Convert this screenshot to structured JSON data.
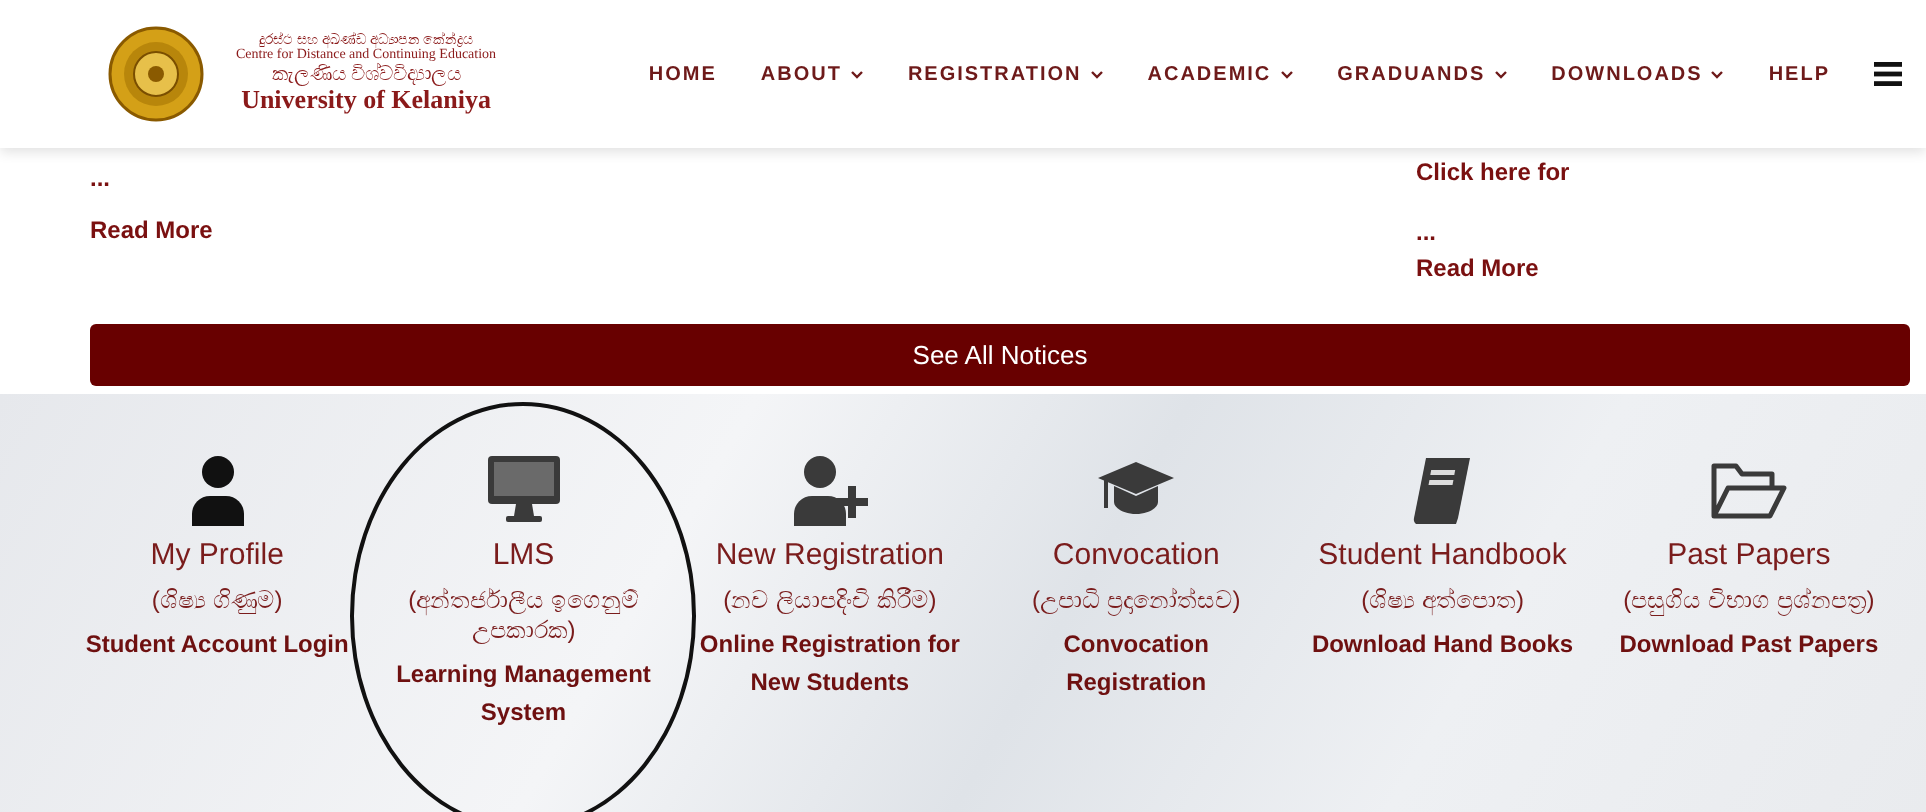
{
  "header": {
    "logo": {
      "line_1": "දුරස්ථ සහ අඛණ්ඩ අධ්‍යාපන කේන්ද්‍රය",
      "line_2": "Centre for Distance and Continuing Education",
      "line_3": "කැලණිය විශ්වවිද්‍යාලය",
      "line_4": "University of Kelaniya"
    },
    "nav": [
      {
        "label": "HOME",
        "dropdown": false
      },
      {
        "label": "ABOUT",
        "dropdown": true
      },
      {
        "label": "REGISTRATION",
        "dropdown": true
      },
      {
        "label": "ACADEMIC",
        "dropdown": true
      },
      {
        "label": "GRADUANDS",
        "dropdown": true
      },
      {
        "label": "DOWNLOADS",
        "dropdown": true
      },
      {
        "label": "HELP",
        "dropdown": false
      }
    ]
  },
  "notices": [
    {
      "lines": [
        "..."
      ],
      "link": "Read More"
    },
    {
      "lines": [
        "Click here for",
        "..."
      ],
      "link": "Read More"
    }
  ],
  "see_all_button": "See All Notices",
  "quick_links": [
    {
      "kind": "user",
      "title": "My Profile",
      "sinhala": "(ශිෂ්‍ය ගිණුම)",
      "subtitle": "Student Account Login",
      "circled": false
    },
    {
      "kind": "monitor",
      "title": "LMS",
      "sinhala": "(අන්තර්ජාලීය ඉගෙනුම් උපකාරක)",
      "subtitle": "Learning Management System",
      "circled": true
    },
    {
      "kind": "user-plus",
      "title": "New Registration",
      "sinhala": "(නව ලියාපදිංචි කිරීම)",
      "subtitle": "Online Registration for New Students",
      "circled": false
    },
    {
      "kind": "cap",
      "title": "Convocation",
      "sinhala": "(උපාධි ප්‍රදානෝත්සව)",
      "subtitle": "Convocation Registration",
      "circled": false
    },
    {
      "kind": "book",
      "title": "Student Handbook",
      "sinhala": "(ශිෂ්‍ය අත්පොත)",
      "subtitle": "Download Hand Books",
      "circled": false
    },
    {
      "kind": "folder",
      "title": "Past Papers",
      "sinhala": "(පසුගිය විභාග ප්‍රශ්නපත්‍ර)",
      "subtitle": "Download Past Papers",
      "circled": false
    }
  ]
}
